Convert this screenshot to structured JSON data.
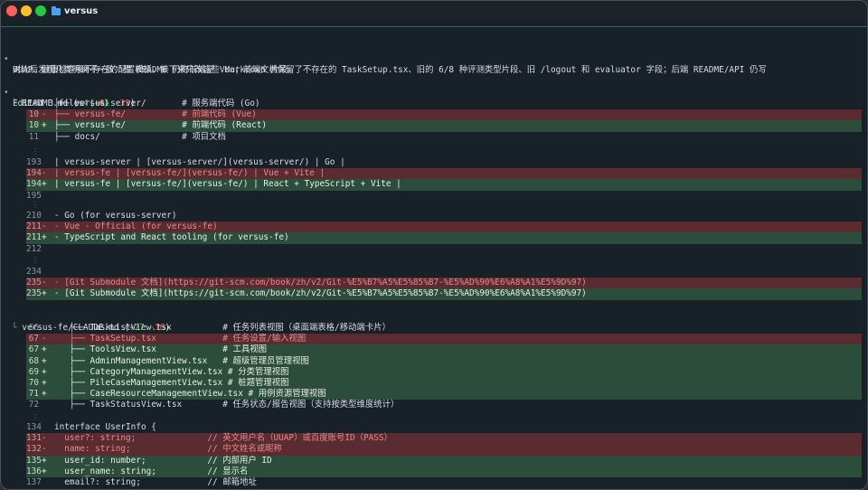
{
  "window": {
    "title": "versus"
  },
  "message": {
    "line1": "对比后发现几类明确不一致：根 README 仍称前端是 Vue；前端文档保留了不存在的 TaskSetup.tsx、旧的 6/8 种评测类型片段、旧 /logout 和 evaluator 字段；后端 README/API 仍写",
    "line2": "UUAP、健康检查和不存在的配置模板。接下来只改这些 Markdown 片段。"
  },
  "summary": {
    "label": "Edited 3 files",
    "added": "+61",
    "removed": "-33"
  },
  "file1": {
    "name": "README.md",
    "added": "+4",
    "removed": "-4"
  },
  "file2": {
    "name": "versus-fe/CLAUDE.md",
    "added": "+27",
    "removed": "-16"
  },
  "hunks": [
    [
      {
        "n": "9",
        "m": " ",
        "t": "├── versus-server/       # 服务端代码 (Go)",
        "k": "ctx"
      },
      {
        "n": "10",
        "m": "-",
        "t": "├── versus-fe/           # 前端代码 (Vue)",
        "k": "del"
      },
      {
        "n": "10",
        "m": "+",
        "t": "├── versus-fe/           # 前端代码 (React)",
        "k": "add"
      },
      {
        "n": "11",
        "m": " ",
        "t": "├── docs/                # 项目文档",
        "k": "ctx"
      }
    ],
    [
      {
        "n": "193",
        "m": " ",
        "t": "| versus-server | [versus-server/](versus-server/) | Go |",
        "k": "ctx"
      },
      {
        "n": "194",
        "m": "-",
        "t": "| versus-fe | [versus-fe/](versus-fe/) | Vue + Vite |",
        "k": "del"
      },
      {
        "n": "194",
        "m": "+",
        "t": "| versus-fe | [versus-fe/](versus-fe/) | React + TypeScript + Vite |",
        "k": "add"
      },
      {
        "n": "195",
        "m": " ",
        "t": "",
        "k": "ctx"
      }
    ],
    [
      {
        "n": "210",
        "m": " ",
        "t": "- Go (for versus-server)",
        "k": "ctx"
      },
      {
        "n": "211",
        "m": "-",
        "t": "- Vue - Official (for versus-fe)",
        "k": "del"
      },
      {
        "n": "211",
        "m": "+",
        "t": "- TypeScript and React tooling (for versus-fe)",
        "k": "add"
      },
      {
        "n": "212",
        "m": " ",
        "t": "",
        "k": "ctx"
      }
    ],
    [
      {
        "n": "234",
        "m": " ",
        "t": "",
        "k": "ctx"
      },
      {
        "n": "235",
        "m": "-",
        "t": "- [Git Submodule 文档](https://git-scm.com/book/zh/v2/Git-%E5%B7%A5%E5%85%B7-%E5%AD%90%E6%A8%A1%E5%9D%97)",
        "k": "del"
      },
      {
        "n": "235",
        "m": "+",
        "t": "- [Git Submodule 文档](https://git-scm.com/book/zh/v2/Git-%E5%B7%A5%E5%85%B7-%E5%AD%90%E6%A8%A1%E5%9D%97)",
        "k": "add"
      }
    ],
    [
      {
        "n": "66",
        "m": " ",
        "t": "   ├── TaskListView.tsx          # 任务列表视图（桌面端表格/移动端卡片）",
        "k": "ctx"
      },
      {
        "n": "67",
        "m": "-",
        "t": "   ├── TaskSetup.tsx             # 任务设置/输入视图",
        "k": "del"
      },
      {
        "n": "67",
        "m": "+",
        "t": "   ├── ToolsView.tsx             # 工具视图",
        "k": "add"
      },
      {
        "n": "68",
        "m": "+",
        "t": "   ├── AdminManagementView.tsx   # 超级管理员管理视图",
        "k": "add"
      },
      {
        "n": "69",
        "m": "+",
        "t": "   ├── CategoryManagementView.tsx # 分类管理视图",
        "k": "add"
      },
      {
        "n": "70",
        "m": "+",
        "t": "   ├── PileCaseManagementView.tsx # 桩题管理视图",
        "k": "add"
      },
      {
        "n": "71",
        "m": "+",
        "t": "   ├── CaseResourceManagementView.tsx # 用例资源管理视图",
        "k": "add"
      },
      {
        "n": "72",
        "m": " ",
        "t": "   ├── TaskStatusView.tsx        # 任务状态/报告视图（支持按类型维度统计）",
        "k": "ctx"
      }
    ],
    [
      {
        "n": "134",
        "m": " ",
        "t": "interface UserInfo {",
        "k": "ctx"
      },
      {
        "n": "131",
        "m": "-",
        "t": "  user?: string;              // 英文用户名（UUAP）或百度账号ID（PASS）",
        "k": "del"
      },
      {
        "n": "132",
        "m": "-",
        "t": "  name: string;               // 中文姓名或昵称",
        "k": "del"
      },
      {
        "n": "135",
        "m": "+",
        "t": "  user_id: number;            // 内部用户 ID",
        "k": "add"
      },
      {
        "n": "136",
        "m": "+",
        "t": "  user_name: string;          // 显示名",
        "k": "add"
      },
      {
        "n": "137",
        "m": " ",
        "t": "  email?: string;             // 邮箱地址",
        "k": "ctx"
      }
    ]
  ]
}
